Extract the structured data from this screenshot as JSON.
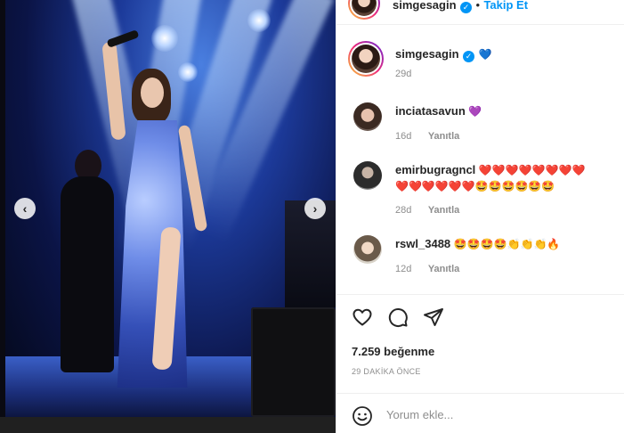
{
  "post": {
    "author": "simgesagin",
    "follow_label": "Takip Et",
    "separator": "•",
    "caption_author": "simgesagin",
    "caption_emoji": "💙",
    "caption_age": "29d"
  },
  "comments": [
    {
      "user": "inciatasavun",
      "text": "💜",
      "age": "16d",
      "reply": "Yanıtla"
    },
    {
      "user": "emirbugragncl",
      "text": "❤️❤️❤️❤️❤️❤️❤️❤️",
      "text2": "❤️❤️❤️❤️❤️❤️🤩🤩🤩🤩🤩🤩",
      "age": "28d",
      "reply": "Yanıtla"
    },
    {
      "user": "rswl_3488",
      "text": "🤩🤩🤩🤩👏👏👏🔥",
      "age": "12d",
      "reply": "Yanıtla"
    }
  ],
  "actions": {
    "like_icon": "heart-outline-icon",
    "comment_icon": "comment-bubble-icon",
    "share_icon": "paper-plane-icon"
  },
  "likes_text": "7.259 beğenme",
  "timestamp": "29 DAKİKA ÖNCE",
  "comment_box": {
    "placeholder": "Yorum ekle...",
    "emoji_icon": "smiley-icon"
  },
  "colors": {
    "accent": "#0095f6",
    "text": "#262626",
    "muted": "#8e8e8e",
    "heart_red": "#e0112b"
  }
}
